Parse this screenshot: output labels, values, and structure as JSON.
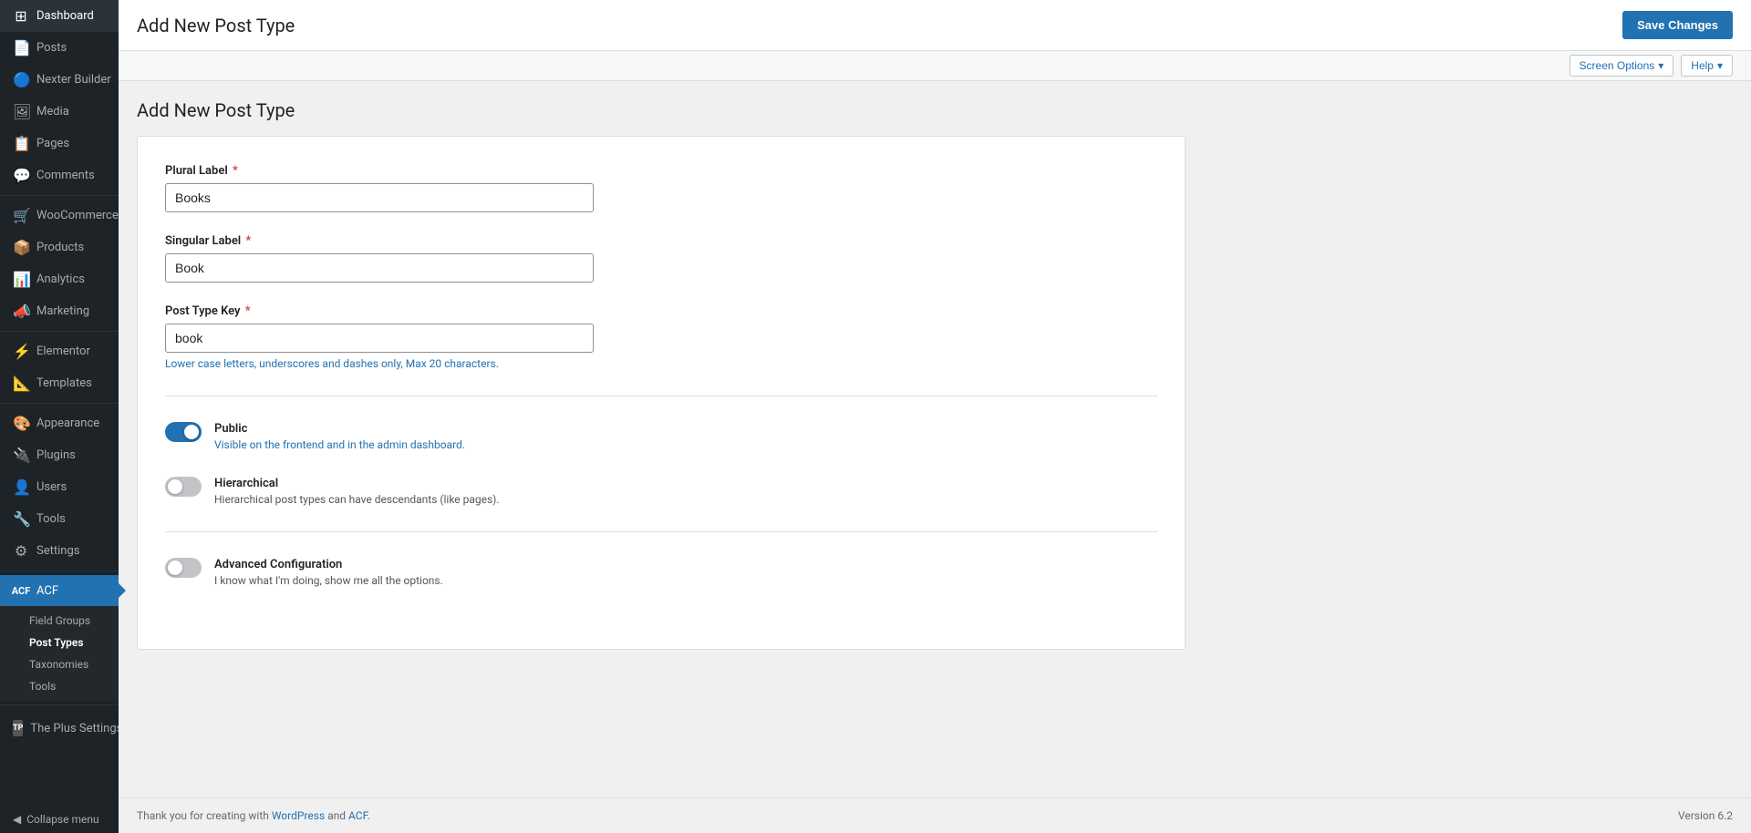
{
  "sidebar": {
    "items": [
      {
        "id": "dashboard",
        "label": "Dashboard",
        "icon": "⊞"
      },
      {
        "id": "posts",
        "label": "Posts",
        "icon": "📄"
      },
      {
        "id": "nexter-builder",
        "label": "Nexter Builder",
        "icon": "🔵"
      },
      {
        "id": "media",
        "label": "Media",
        "icon": "🖼"
      },
      {
        "id": "pages",
        "label": "Pages",
        "icon": "📋"
      },
      {
        "id": "comments",
        "label": "Comments",
        "icon": "💬"
      },
      {
        "id": "woocommerce",
        "label": "WooCommerce",
        "icon": "🛒"
      },
      {
        "id": "products",
        "label": "Products",
        "icon": "📦"
      },
      {
        "id": "analytics",
        "label": "Analytics",
        "icon": "📊"
      },
      {
        "id": "marketing",
        "label": "Marketing",
        "icon": "📣"
      },
      {
        "id": "elementor",
        "label": "Elementor",
        "icon": "⚡"
      },
      {
        "id": "templates",
        "label": "Templates",
        "icon": "📐"
      },
      {
        "id": "appearance",
        "label": "Appearance",
        "icon": "🎨"
      },
      {
        "id": "plugins",
        "label": "Plugins",
        "icon": "🔌"
      },
      {
        "id": "users",
        "label": "Users",
        "icon": "👤"
      },
      {
        "id": "tools",
        "label": "Tools",
        "icon": "🔧"
      },
      {
        "id": "settings",
        "label": "Settings",
        "icon": "⚙"
      },
      {
        "id": "acf",
        "label": "ACF",
        "icon": "⬛"
      }
    ],
    "acf_submenu": [
      {
        "id": "field-groups",
        "label": "Field Groups",
        "active": false
      },
      {
        "id": "post-types",
        "label": "Post Types",
        "active": true
      },
      {
        "id": "taxonomies",
        "label": "Taxonomies",
        "active": false
      },
      {
        "id": "tools",
        "label": "Tools",
        "active": false
      }
    ],
    "plus_settings": {
      "label": "The Plus Settings",
      "icon": "⬛"
    },
    "collapse": "Collapse menu"
  },
  "topbar": {
    "title": "Add New Post Type",
    "save_button": "Save Changes"
  },
  "screen_options": {
    "screen_options_label": "Screen Options",
    "help_label": "Help"
  },
  "content": {
    "heading": "Add New Post Type",
    "form": {
      "plural_label": {
        "label": "Plural Label",
        "required": true,
        "value": "Books",
        "placeholder": ""
      },
      "singular_label": {
        "label": "Singular Label",
        "required": true,
        "value": "Book",
        "placeholder": ""
      },
      "post_type_key": {
        "label": "Post Type Key",
        "required": true,
        "value": "book",
        "placeholder": "",
        "hint": "Lower case letters, underscores and dashes only, Max 20 characters."
      },
      "toggles": [
        {
          "id": "public",
          "label": "Public",
          "description": "Visible on the frontend and in the admin dashboard.",
          "enabled": true,
          "desc_blue": true
        },
        {
          "id": "hierarchical",
          "label": "Hierarchical",
          "description": "Hierarchical post types can have descendants (like pages).",
          "enabled": false,
          "desc_blue": false
        },
        {
          "id": "advanced-configuration",
          "label": "Advanced Configuration",
          "description": "I know what I'm doing, show me all the options.",
          "enabled": false,
          "desc_blue": false
        }
      ]
    }
  },
  "footer": {
    "thank_you_text": "Thank you for creating with ",
    "wordpress_link": "WordPress",
    "and_text": " and ",
    "acf_link": "ACF",
    "period": ".",
    "version": "Version 6.2"
  }
}
